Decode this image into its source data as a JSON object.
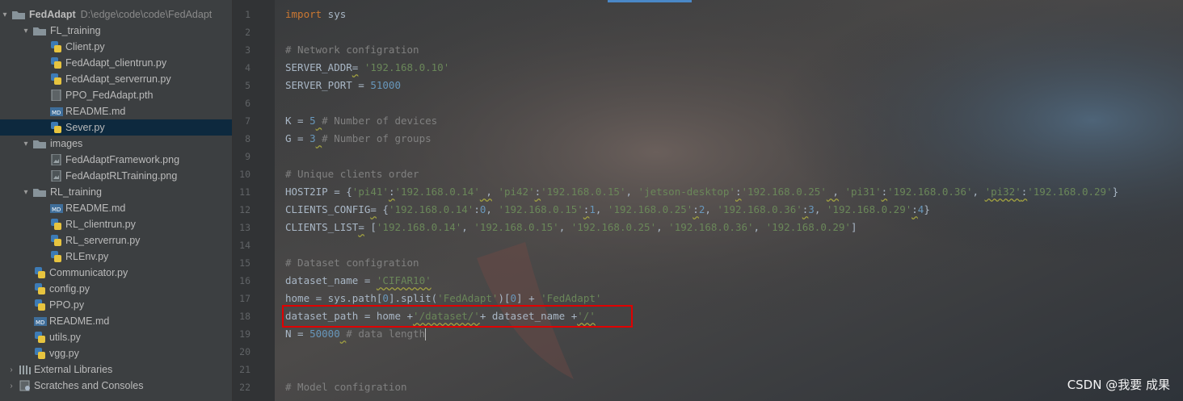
{
  "project_tree": {
    "root": {
      "label": "FedAdapt",
      "path": "D:\\edge\\code\\code\\FedAdapt"
    },
    "items": [
      {
        "label": "FL_training",
        "kind": "folder",
        "level": 1,
        "expanded": true
      },
      {
        "label": "Client.py",
        "kind": "py",
        "level": 2
      },
      {
        "label": "FedAdapt_clientrun.py",
        "kind": "py",
        "level": 2
      },
      {
        "label": "FedAdapt_serverrun.py",
        "kind": "py",
        "level": 2
      },
      {
        "label": "PPO_FedAdapt.pth",
        "kind": "file",
        "level": 2
      },
      {
        "label": "README.md",
        "kind": "md",
        "level": 2
      },
      {
        "label": "Sever.py",
        "kind": "py",
        "level": 2,
        "selected": true
      },
      {
        "label": "images",
        "kind": "folder",
        "level": 1,
        "expanded": true
      },
      {
        "label": "FedAdaptFramework.png",
        "kind": "img",
        "level": 2
      },
      {
        "label": "FedAdaptRLTraining.png",
        "kind": "img",
        "level": 2
      },
      {
        "label": "RL_training",
        "kind": "folder",
        "level": 1,
        "expanded": true
      },
      {
        "label": "README.md",
        "kind": "md",
        "level": 2
      },
      {
        "label": "RL_clientrun.py",
        "kind": "py",
        "level": 2
      },
      {
        "label": "RL_serverrun.py",
        "kind": "py",
        "level": 2
      },
      {
        "label": "RLEnv.py",
        "kind": "py",
        "level": 2
      },
      {
        "label": "Communicator.py",
        "kind": "py",
        "level": 1
      },
      {
        "label": "config.py",
        "kind": "py",
        "level": 1
      },
      {
        "label": "PPO.py",
        "kind": "py",
        "level": 1
      },
      {
        "label": "README.md",
        "kind": "md",
        "level": 1
      },
      {
        "label": "utils.py",
        "kind": "py",
        "level": 1
      },
      {
        "label": "vgg.py",
        "kind": "py",
        "level": 1
      },
      {
        "label": "External Libraries",
        "kind": "lib",
        "level": 0
      },
      {
        "label": "Scratches and Consoles",
        "kind": "scratch",
        "level": 0
      }
    ]
  },
  "editor": {
    "line_numbers": [
      "1",
      "2",
      "3",
      "4",
      "5",
      "6",
      "7",
      "8",
      "9",
      "10",
      "11",
      "12",
      "13",
      "14",
      "15",
      "16",
      "17",
      "18",
      "19",
      "20",
      "21",
      "22"
    ],
    "lines": [
      [
        {
          "t": "import",
          "c": "kw"
        },
        {
          "t": " sys",
          "c": "plain"
        }
      ],
      [],
      [
        {
          "t": "# Network configration",
          "c": "cm"
        }
      ],
      [
        {
          "t": "SERVER_ADDR",
          "c": "plain"
        },
        {
          "t": "=",
          "c": "plain",
          "w": true
        },
        {
          "t": " ",
          "c": "plain"
        },
        {
          "t": "'192.168.0.10'",
          "c": "str"
        }
      ],
      [
        {
          "t": "SERVER_PORT = ",
          "c": "plain"
        },
        {
          "t": "51000",
          "c": "num"
        }
      ],
      [],
      [
        {
          "t": "K = ",
          "c": "plain"
        },
        {
          "t": "5",
          "c": "num"
        },
        {
          "t": " ",
          "c": "plain",
          "w": true
        },
        {
          "t": "# Number of devices",
          "c": "cm"
        }
      ],
      [
        {
          "t": "G = ",
          "c": "plain"
        },
        {
          "t": "3",
          "c": "num"
        },
        {
          "t": " ",
          "c": "plain",
          "w": true
        },
        {
          "t": "# Number of groups",
          "c": "cm"
        }
      ],
      [],
      [
        {
          "t": "# Unique clients order",
          "c": "cm"
        }
      ],
      [
        {
          "t": "HOST2IP = {",
          "c": "plain"
        },
        {
          "t": "'pi41'",
          "c": "str"
        },
        {
          "t": ":",
          "c": "plain",
          "w": true
        },
        {
          "t": "'192.168.0.14'",
          "c": "str"
        },
        {
          "t": " ,",
          "c": "plain",
          "w": true
        },
        {
          "t": " ",
          "c": "plain"
        },
        {
          "t": "'pi42'",
          "c": "str"
        },
        {
          "t": ":",
          "c": "plain",
          "w": true
        },
        {
          "t": "'192.168.0.15'",
          "c": "str"
        },
        {
          "t": ", ",
          "c": "plain"
        },
        {
          "t": "'jetson-desktop'",
          "c": "str"
        },
        {
          "t": ":",
          "c": "plain",
          "w": true
        },
        {
          "t": "'192.168.0.25'",
          "c": "str"
        },
        {
          "t": " ,",
          "c": "plain",
          "w": true
        },
        {
          "t": " ",
          "c": "plain"
        },
        {
          "t": "'pi31'",
          "c": "str"
        },
        {
          "t": ":",
          "c": "plain",
          "w": true
        },
        {
          "t": "'192.168.0.36'",
          "c": "str"
        },
        {
          "t": ", ",
          "c": "plain"
        },
        {
          "t": "'pi32'",
          "c": "str",
          "w": true
        },
        {
          "t": ":",
          "c": "plain",
          "w": true
        },
        {
          "t": "'192.168.0.29'",
          "c": "str"
        },
        {
          "t": "}",
          "c": "plain"
        }
      ],
      [
        {
          "t": "CLIENTS_CONFIG",
          "c": "plain"
        },
        {
          "t": "=",
          "c": "plain",
          "w": true
        },
        {
          "t": " {",
          "c": "plain"
        },
        {
          "t": "'192.168.0.14'",
          "c": "str"
        },
        {
          "t": ":",
          "c": "plain"
        },
        {
          "t": "0",
          "c": "num"
        },
        {
          "t": ", ",
          "c": "plain"
        },
        {
          "t": "'192.168.0.15'",
          "c": "str"
        },
        {
          "t": ":",
          "c": "plain",
          "w": true
        },
        {
          "t": "1",
          "c": "num"
        },
        {
          "t": ", ",
          "c": "plain"
        },
        {
          "t": "'192.168.0.25'",
          "c": "str"
        },
        {
          "t": ":",
          "c": "plain",
          "w": true
        },
        {
          "t": "2",
          "c": "num"
        },
        {
          "t": ", ",
          "c": "plain"
        },
        {
          "t": "'192.168.0.36'",
          "c": "str"
        },
        {
          "t": ":",
          "c": "plain",
          "w": true
        },
        {
          "t": "3",
          "c": "num"
        },
        {
          "t": ", ",
          "c": "plain"
        },
        {
          "t": "'192.168.0.29'",
          "c": "str"
        },
        {
          "t": ":",
          "c": "plain",
          "w": true
        },
        {
          "t": "4",
          "c": "num"
        },
        {
          "t": "}",
          "c": "plain"
        }
      ],
      [
        {
          "t": "CLIENTS_LIST",
          "c": "plain"
        },
        {
          "t": "=",
          "c": "plain",
          "w": true
        },
        {
          "t": " [",
          "c": "plain"
        },
        {
          "t": "'192.168.0.14'",
          "c": "str"
        },
        {
          "t": ", ",
          "c": "plain"
        },
        {
          "t": "'192.168.0.15'",
          "c": "str"
        },
        {
          "t": ", ",
          "c": "plain"
        },
        {
          "t": "'192.168.0.25'",
          "c": "str"
        },
        {
          "t": ", ",
          "c": "plain"
        },
        {
          "t": "'192.168.0.36'",
          "c": "str"
        },
        {
          "t": ", ",
          "c": "plain"
        },
        {
          "t": "'192.168.0.29'",
          "c": "str"
        },
        {
          "t": "]",
          "c": "plain"
        }
      ],
      [],
      [
        {
          "t": "# Dataset configration",
          "c": "cm"
        }
      ],
      [
        {
          "t": "dataset_name = ",
          "c": "plain"
        },
        {
          "t": "'CIFAR10'",
          "c": "str",
          "w": true
        }
      ],
      [
        {
          "t": "home = sys.path[",
          "c": "plain"
        },
        {
          "t": "0",
          "c": "num"
        },
        {
          "t": "].split(",
          "c": "plain"
        },
        {
          "t": "'FedAdapt'",
          "c": "str"
        },
        {
          "t": ")[",
          "c": "plain"
        },
        {
          "t": "0",
          "c": "num"
        },
        {
          "t": "] + ",
          "c": "plain"
        },
        {
          "t": "'FedAdapt'",
          "c": "str"
        }
      ],
      [
        {
          "t": "dataset_path = home +",
          "c": "plain"
        },
        {
          "t": "'/dataset/'",
          "c": "str",
          "w": true
        },
        {
          "t": "+ dataset_name +",
          "c": "plain"
        },
        {
          "t": "'/'",
          "c": "str",
          "w": true
        }
      ],
      [
        {
          "t": "N = ",
          "c": "plain"
        },
        {
          "t": "50000",
          "c": "num"
        },
        {
          "t": " ",
          "c": "plain",
          "w": true
        },
        {
          "t": "# data length",
          "c": "cm"
        },
        {
          "t": "",
          "c": "caret"
        }
      ],
      [],
      [],
      [
        {
          "t": "# Model configration",
          "c": "cm"
        }
      ]
    ]
  },
  "watermark": "CSDN @我要 成果",
  "colors": {
    "keyword": "#cc7832",
    "string": "#6a8759",
    "number": "#6897bb",
    "comment": "#808080",
    "highlight_box": "#e00000"
  }
}
